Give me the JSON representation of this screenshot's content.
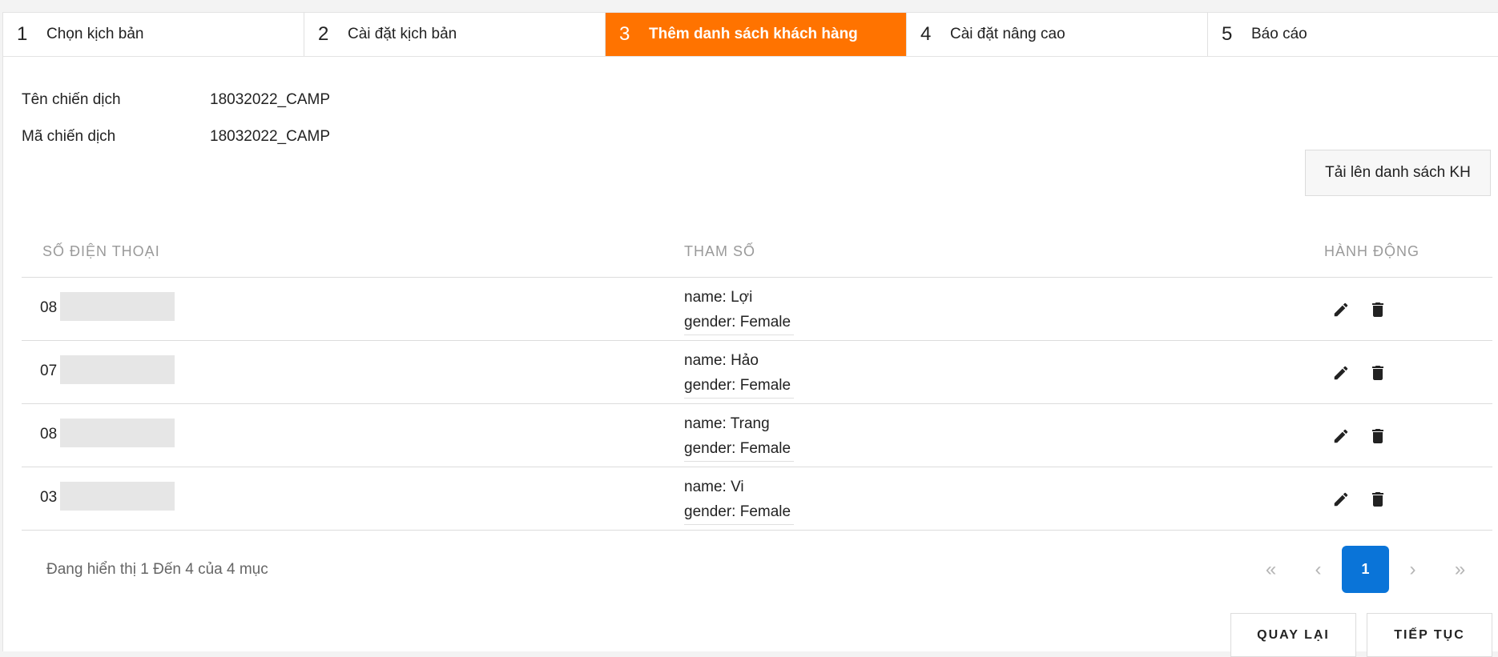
{
  "steps": [
    {
      "num": "1",
      "label": "Chọn kịch bản"
    },
    {
      "num": "2",
      "label": "Cài đặt kịch bản"
    },
    {
      "num": "3",
      "label": "Thêm danh sách khách hàng"
    },
    {
      "num": "4",
      "label": "Cài đặt nâng cao"
    },
    {
      "num": "5",
      "label": "Báo cáo"
    }
  ],
  "active_step": 3,
  "accent_color": "#ff7300",
  "campaign": {
    "name_label": "Tên chiến dịch",
    "name_value": "18032022_CAMP",
    "code_label": "Mã chiến dịch",
    "code_value": "18032022_CAMP"
  },
  "upload_button": "Tải lên danh sách KH",
  "table": {
    "headers": {
      "phone": "SỐ ĐIỆN THOẠI",
      "params": "THAM SỐ",
      "actions": "HÀNH ĐỘNG"
    },
    "rows": [
      {
        "phone": "08",
        "name": "name: Lợi",
        "gender": "gender: Female"
      },
      {
        "phone": "07",
        "name": "name: Hảo",
        "gender": "gender: Female"
      },
      {
        "phone": "08",
        "name": "name: Trang",
        "gender": "gender: Female"
      },
      {
        "phone": "03",
        "name": "name: Vi",
        "gender": "gender: Female"
      }
    ],
    "action_icons": [
      "pencil-icon",
      "trash-icon"
    ]
  },
  "pagination": {
    "summary": "Đang hiển thị 1 Đến 4 của 4 mục",
    "first": "«",
    "prev": "‹",
    "current_page": "1",
    "next": "›",
    "last": "»",
    "current_color": "#0a74d8"
  },
  "buttons": {
    "back": "QUAY LẠI",
    "next": "TIẾP TỤC"
  }
}
